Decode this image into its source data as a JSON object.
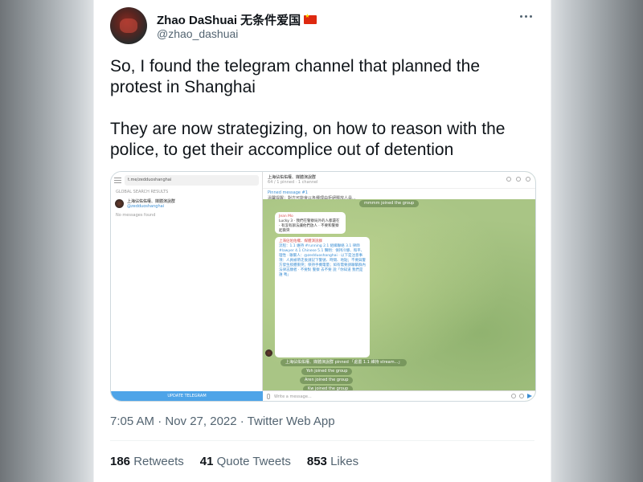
{
  "user": {
    "display_name": "Zhao DaShuai 无条件爱国",
    "handle": "@zhao_dashuai"
  },
  "tweet": {
    "paragraphs": [
      "So, I found the telegram channel that planned the protest in Shanghai",
      "They are now strategizing, on how to reason with the police, to get their accomplice out of detention"
    ],
    "timestamp": "7:05 AM · Nov 27, 2022 · Twitter Web App"
  },
  "stats": {
    "retweets_count": "186",
    "retweets_label": "Retweets",
    "quotes_count": "41",
    "quotes_label": "Quote Tweets",
    "likes_count": "853",
    "likes_label": "Likes"
  },
  "telegram": {
    "search_value": "t.me/zedduoshanghai",
    "search_section": "GLOBAL SEARCH RESULTS",
    "result_title": "上海佔佑佑權、媒體演說群",
    "result_handle": "@zedduoshanghai",
    "no_messages": "No messages found",
    "update_button": "UPDATE TELEGRAM",
    "header_title": "上海佔佑佑權、媒體演說群",
    "header_subtitle": "64 / 1 pinned · 1 channel",
    "pinned_label": "Pinned message #1",
    "pinned_text": "溫馨提醒：對方可能會以各種理由拒絕釋放人員...",
    "joined_1": "mmmm joined the group",
    "joined_2": "上海佔佑佑權、媒體演說群 pinned 「處置 1.1 維持 stream...」",
    "joined_3": "Yoh joined the group",
    "joined_4": "Aren joined the group",
    "joined_5": "Kw joined the group",
    "input_placeholder": "Write a message...",
    "bubble1_name": "Jean Mo",
    "bubble1_text": "Lucky 3 · 我們在警察局外的人都還在 · 有沒有辦法讓他們放人 · 不要和警察起衝突",
    "bubble2_name": "上海佔佑佑權、媒體演說群",
    "bubble2_text": "流程：1.1 維持 #running 2.1 組織聯絡 3.1 律師 #lawyer 4.1 Chinese 5.1 聲明：保持冷靜、和平、理性 · 聯繫人：@zedduoshanghai · 以下是注意事項：人員被帶走後請記下警號、時間、地點；不要與警方發生肢體衝突；保持手機電量；如有需要請聯繫群內法律志願者 · 不要對 警察 去不要 說「你知道 我們是誰 嗎」"
  }
}
